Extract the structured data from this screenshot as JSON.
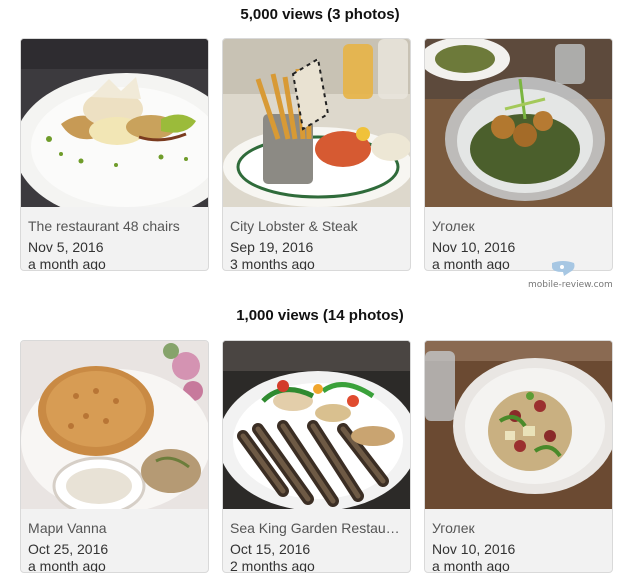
{
  "sections": [
    {
      "title": "5,000 views (3 photos)"
    },
    {
      "title": "1,000 views (14 photos)"
    }
  ],
  "cards": [
    {
      "place": "The restaurant 48 chairs",
      "date": "Nov 5, 2016",
      "ago": "a month ago"
    },
    {
      "place": "City Lobster & Steak",
      "date": "Sep 19, 2016",
      "ago": "3 months ago"
    },
    {
      "place": "Уголек",
      "date": "Nov 10, 2016",
      "ago": "a month ago"
    },
    {
      "place": "Мари Vanna",
      "date": "Oct 25, 2016",
      "ago": "a month ago"
    },
    {
      "place": "Sea King Garden Restaur…",
      "date": "Oct 15, 2016",
      "ago": "2 months ago"
    },
    {
      "place": "Уголек",
      "date": "Nov 10, 2016",
      "ago": "a month ago"
    }
  ],
  "watermark": {
    "text": "mobile-review.com",
    "icon": "speech-bubble-icon"
  }
}
